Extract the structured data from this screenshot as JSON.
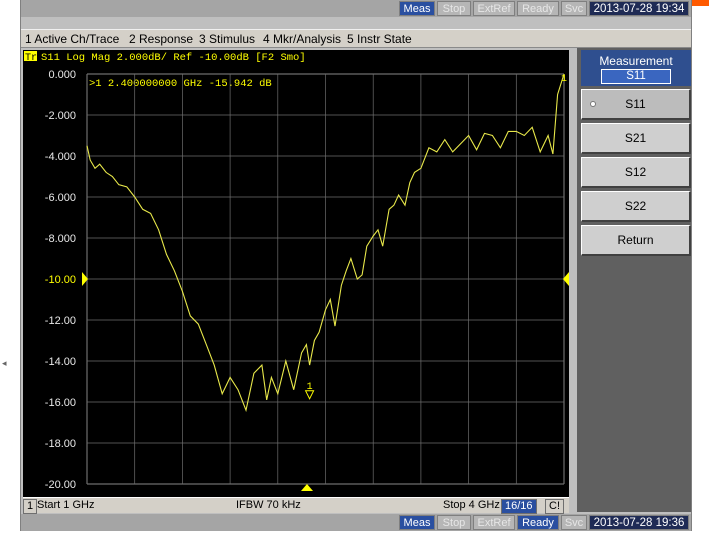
{
  "top_status": {
    "meas": "Meas",
    "stop": "Stop",
    "extref": "ExtRef",
    "ready": "Ready",
    "svc": "Svc",
    "time": "2013-07-28 19:34"
  },
  "menu": [
    "1 Active Ch/Trace",
    "2 Response",
    "3 Stimulus",
    "4 Mkr/Analysis",
    "5 Instr State"
  ],
  "trace": {
    "label": "Tr1",
    "header": "S11 Log Mag 2.000dB/ Ref -10.00dB [F2 Smo]",
    "marker_readout": ">1  2.400000000 GHz -15.942 dB",
    "marker_label": "1",
    "end_marker_label": "1"
  },
  "y_ticks": [
    "0.000",
    "-2.000",
    "-4.000",
    "-6.000",
    "-8.000",
    "-10.00",
    "-12.00",
    "-14.00",
    "-16.00",
    "-18.00",
    "-20.00"
  ],
  "channel_bar": {
    "channel": "1",
    "start": "Start 1 GHz",
    "ifbw": "IFBW 70 kHz",
    "stop": "Stop 4 GHz",
    "points": "16/16",
    "cal": "C!"
  },
  "bottom_status": {
    "meas": "Meas",
    "stop": "Stop",
    "extref": "ExtRef",
    "ready": "Ready",
    "svc": "Svc",
    "time": "2013-07-28 19:36"
  },
  "softkeys": {
    "title": "Measurement",
    "value": "S11",
    "items": [
      "S11",
      "S21",
      "S12",
      "S22",
      "Return"
    ]
  },
  "colors": {
    "trace": "#e8e84a",
    "grid": "#6e6e6e",
    "label": "#ffff00",
    "plot_bg": "#000000"
  },
  "chart_data": {
    "type": "line",
    "title": "S11 Log Mag 2.000dB/ Ref -10.00dB [F2 Smo]",
    "xlabel": "",
    "ylabel": "",
    "xlim": [
      1,
      4
    ],
    "ylim": [
      -20,
      0
    ],
    "grid": true,
    "series": [
      {
        "x": [
          1.0,
          1.02,
          1.05,
          1.08,
          1.12,
          1.16,
          1.2,
          1.25,
          1.3,
          1.35,
          1.4,
          1.45,
          1.5,
          1.55,
          1.6,
          1.65,
          1.7,
          1.75,
          1.8,
          1.85,
          1.9,
          1.95,
          2.0,
          2.05,
          2.1,
          2.13,
          2.16,
          2.2,
          2.25,
          2.3,
          2.35,
          2.38,
          2.4,
          2.43,
          2.46,
          2.5,
          2.53,
          2.56,
          2.6,
          2.63,
          2.66,
          2.7,
          2.73,
          2.76,
          2.8,
          2.83,
          2.86,
          2.9,
          2.93,
          2.96,
          3.0,
          3.03,
          3.06,
          3.1,
          3.15,
          3.2,
          3.25,
          3.3,
          3.35,
          3.4,
          3.45,
          3.5,
          3.55,
          3.6,
          3.65,
          3.7,
          3.75,
          3.8,
          3.85,
          3.9,
          3.93,
          3.96,
          4.0
        ],
        "y": [
          -3.5,
          -4.2,
          -4.6,
          -4.4,
          -4.8,
          -5.0,
          -5.4,
          -5.5,
          -6.0,
          -6.6,
          -6.8,
          -7.6,
          -8.8,
          -9.6,
          -10.6,
          -11.8,
          -12.2,
          -13.2,
          -14.2,
          -15.6,
          -14.8,
          -15.4,
          -16.4,
          -14.6,
          -14.2,
          -15.9,
          -14.8,
          -15.6,
          -14.0,
          -15.4,
          -13.6,
          -13.2,
          -14.2,
          -13.0,
          -12.6,
          -11.5,
          -11.0,
          -12.3,
          -10.3,
          -9.6,
          -9.0,
          -10.0,
          -9.8,
          -8.4,
          -7.9,
          -7.6,
          -8.4,
          -6.6,
          -6.4,
          -5.9,
          -6.4,
          -5.3,
          -4.8,
          -4.6,
          -3.6,
          -3.8,
          -3.2,
          -3.8,
          -3.4,
          -3.0,
          -3.7,
          -2.9,
          -3.0,
          -3.6,
          -2.8,
          -2.8,
          -3.0,
          -2.6,
          -3.8,
          -3.0,
          -3.9,
          -1.0,
          0.0
        ]
      }
    ],
    "markers": [
      {
        "x": 2.4,
        "y": -15.942,
        "label": "1"
      }
    ]
  }
}
